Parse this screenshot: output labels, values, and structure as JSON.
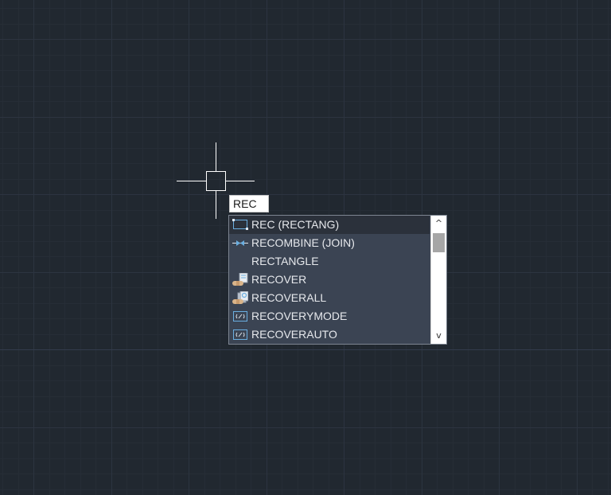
{
  "command_input": {
    "value": "REC"
  },
  "autocomplete": {
    "items": [
      {
        "label": "REC (RECTANG)",
        "icon": "rectangle-icon",
        "active": true
      },
      {
        "label": "RECOMBINE (JOIN)",
        "icon": "join-icon",
        "active": false
      },
      {
        "label": "RECTANGLE",
        "icon": "",
        "active": false
      },
      {
        "label": "RECOVER",
        "icon": "recover-icon",
        "active": false
      },
      {
        "label": "RECOVERALL",
        "icon": "recover-all-icon",
        "active": false
      },
      {
        "label": "RECOVERYMODE",
        "icon": "system-variable-icon",
        "active": false
      },
      {
        "label": "RECOVERAUTO",
        "icon": "system-variable-icon",
        "active": false
      }
    ],
    "scroll_up_glyph": "^",
    "scroll_down_glyph": "v"
  },
  "colors": {
    "canvas_background": "#212830",
    "dropdown_background": "#3b4453",
    "dropdown_highlight": "#2b313b",
    "icon_blue": "#6aaee0",
    "crosshair": "#ffffff"
  }
}
